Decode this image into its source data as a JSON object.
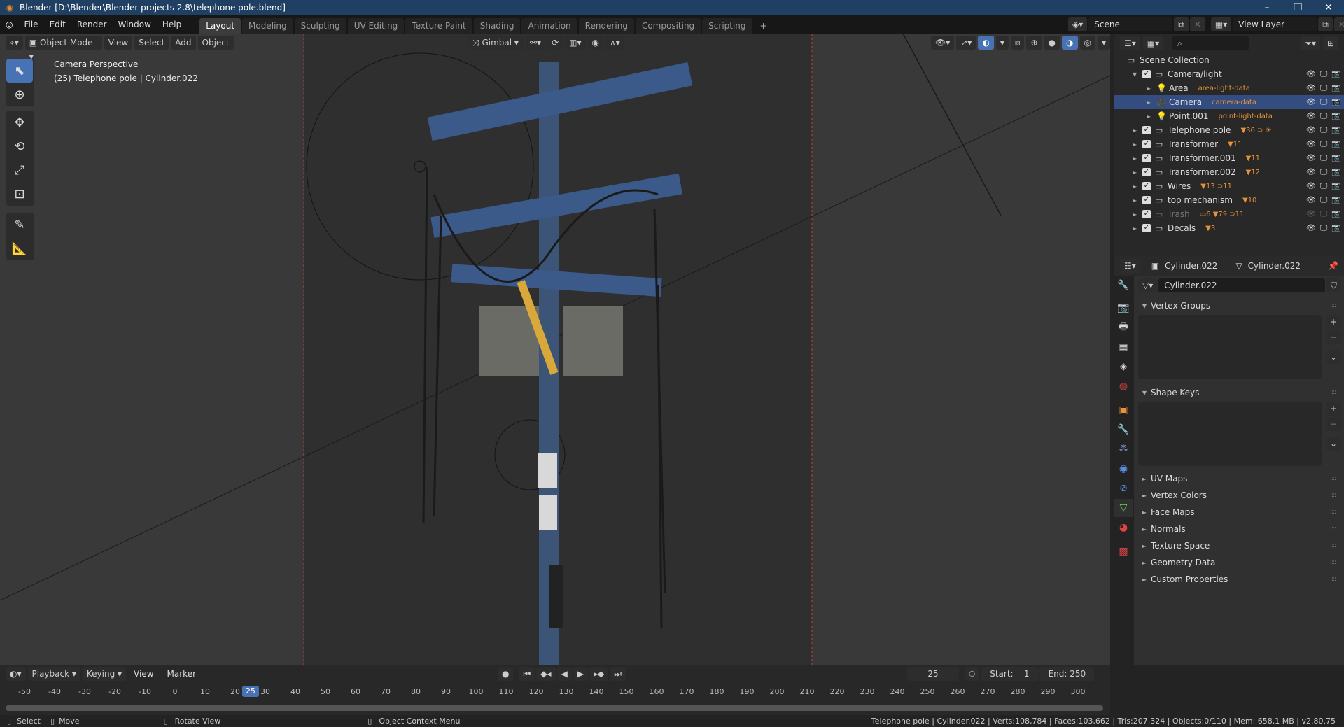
{
  "window": {
    "title": "Blender [D:\\Blender\\Blender projects 2.8\\telephone pole.blend]",
    "minimize": "–",
    "maximize": "❐",
    "close": "✕"
  },
  "menu": [
    "File",
    "Edit",
    "Render",
    "Window",
    "Help"
  ],
  "workspaces": [
    {
      "label": "Layout",
      "active": true
    },
    {
      "label": "Modeling"
    },
    {
      "label": "Sculpting"
    },
    {
      "label": "UV Editing"
    },
    {
      "label": "Texture Paint"
    },
    {
      "label": "Shading"
    },
    {
      "label": "Animation"
    },
    {
      "label": "Rendering"
    },
    {
      "label": "Compositing"
    },
    {
      "label": "Scripting"
    }
  ],
  "add_workspace": "+",
  "scene": {
    "name": "Scene",
    "view_layer": "View Layer"
  },
  "viewport_header": {
    "mode": "Object Mode",
    "menus": [
      "View",
      "Select",
      "Add",
      "Object"
    ],
    "orientation": "Gimbal"
  },
  "viewport_overlay": {
    "line1": "Camera Perspective",
    "line2": "(25) Telephone pole | Cylinder.022"
  },
  "tools": [
    "select-box",
    "cursor",
    "move",
    "rotate",
    "scale",
    "transform",
    "annotate",
    "measure"
  ],
  "outliner": {
    "root": "Scene Collection",
    "rows": [
      {
        "label": "Camera/light",
        "level": 1,
        "expanded": true,
        "type": "collection",
        "badges": ""
      },
      {
        "label": "Area",
        "level": 2,
        "type": "light",
        "badges": "area-light-data"
      },
      {
        "label": "Camera",
        "level": 2,
        "type": "camera",
        "selected": true,
        "badges": "camera-data"
      },
      {
        "label": "Point.001",
        "level": 2,
        "type": "light",
        "badges": "point-light-data"
      },
      {
        "label": "Telephone pole",
        "level": 1,
        "type": "collection",
        "badges": "▼36 ⊃ ☀"
      },
      {
        "label": "Transformer",
        "level": 1,
        "type": "collection",
        "badges": "▼11"
      },
      {
        "label": "Transformer.001",
        "level": 1,
        "type": "collection",
        "badges": "▼11"
      },
      {
        "label": "Transformer.002",
        "level": 1,
        "type": "collection",
        "badges": "▼12"
      },
      {
        "label": "Wires",
        "level": 1,
        "type": "collection",
        "badges": "▼13 ⊃11"
      },
      {
        "label": "top mechanism",
        "level": 1,
        "type": "collection",
        "badges": "▼10"
      },
      {
        "label": "Trash",
        "level": 1,
        "type": "collection",
        "dim": true,
        "badges": "▭6 ▼79 ⊃11"
      },
      {
        "label": "Decals",
        "level": 1,
        "type": "collection",
        "badges": "▼3"
      }
    ]
  },
  "properties": {
    "object_name": "Cylinder.022",
    "mesh_name": "Cylinder.022",
    "data_field": "Cylinder.022",
    "panels": [
      {
        "label": "Vertex Groups",
        "expanded": true
      },
      {
        "label": "Shape Keys",
        "expanded": true
      },
      {
        "label": "UV Maps"
      },
      {
        "label": "Vertex Colors"
      },
      {
        "label": "Face Maps"
      },
      {
        "label": "Normals"
      },
      {
        "label": "Texture Space"
      },
      {
        "label": "Geometry Data"
      },
      {
        "label": "Custom Properties"
      }
    ]
  },
  "timeline": {
    "menus": [
      "Playback",
      "Keying",
      "View",
      "Marker"
    ],
    "current_frame": "25",
    "start_label": "Start:",
    "start": "1",
    "end_label": "End:",
    "end": "250",
    "ticks": [
      "-50",
      "-40",
      "-30",
      "-20",
      "-10",
      "0",
      "10",
      "20",
      "30",
      "40",
      "50",
      "60",
      "70",
      "80",
      "90",
      "100",
      "110",
      "120",
      "130",
      "140",
      "150",
      "160",
      "170",
      "180",
      "190",
      "200",
      "210",
      "220",
      "230",
      "240",
      "250",
      "260",
      "270",
      "280",
      "290",
      "300"
    ]
  },
  "statusbar": {
    "select": "Select",
    "move": "Move",
    "rotate": "Rotate View",
    "context": "Object Context Menu",
    "stats": "Telephone pole | Cylinder.022 | Verts:108,784 | Faces:103,662 | Tris:207,324 | Objects:0/110 | Mem: 658.1 MB | v2.80.75"
  }
}
